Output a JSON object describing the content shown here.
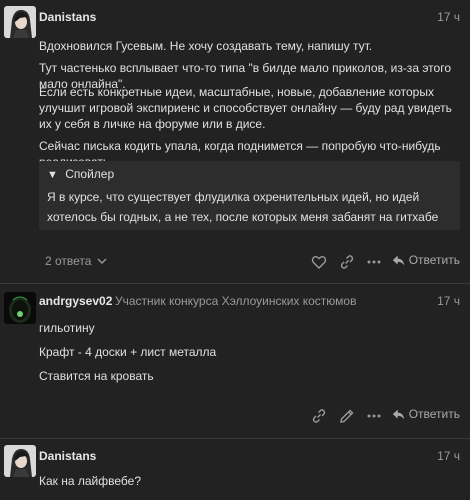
{
  "posts": [
    {
      "username": "Danistans",
      "time": "17 ч",
      "paragraphs": [
        "Вдохновился Гусевым. Не хочу создавать тему, напишу тут.",
        "Тут частенько всплывает что-то типа \"в билде мало приколов, из-за этого мало онлайна\".",
        "Если есть конкретные идеи, масштабные, новые, добавление которых улучшит игровой экспириенс и способствует онлайну — буду рад увидеть их у себя в личке на форуме или в дисе.",
        "Сейчас писька кодить упала, когда поднимется — попробую что-нибудь реализовать."
      ],
      "spoiler": {
        "title": "Спойлер",
        "text": "Я в курсе, что существует флудилка охренительных идей, но идей хотелось бы годных, а не тех, после которых меня забанят на гитхабе"
      },
      "replies_label": "2 ответа",
      "reply_label": "Ответить"
    },
    {
      "username": "andrgysev02",
      "user_title": "Участник конкурса Хэллоуинских костюмов",
      "time": "17 ч",
      "paragraphs": [
        "гильотину",
        "Крафт - 4 доски + лист металла",
        "Ставится на кровать"
      ],
      "reply_label": "Ответить"
    },
    {
      "username": "Danistans",
      "time": "17 ч",
      "paragraphs": [
        "Как на лайфвебе?"
      ]
    }
  ],
  "icons": {
    "like": "heart-icon",
    "link": "link-icon",
    "more": "ellipsis-icon",
    "reply": "reply-arrow-icon",
    "edit": "pencil-icon",
    "expand": "chevron-down-icon",
    "spoiler": "triangle-down-icon"
  },
  "colors": {
    "background": "#222222",
    "spoiler_bg": "#2d2d2d",
    "muted_text": "#9a9a9a"
  }
}
